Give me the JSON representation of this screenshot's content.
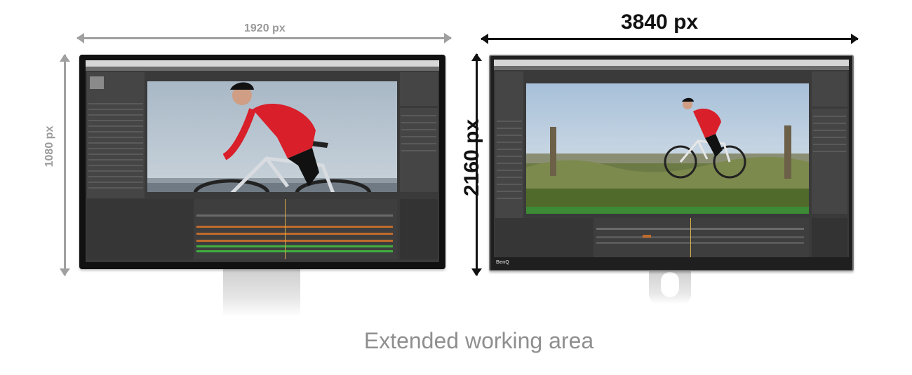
{
  "left_monitor": {
    "width_label": "1920 px",
    "height_label": "1080 px"
  },
  "right_monitor": {
    "width_label": "3840 px",
    "height_label": "2160 px",
    "brand": "BenQ"
  },
  "caption": "Extended working area",
  "colors": {
    "small_arrow": "#a0a0a0",
    "big_arrow": "#111111",
    "cyclist_jersey": "#d81f2a",
    "timeline_orange": "#c06a2c",
    "timeline_green": "#3fae3f"
  },
  "icons": [
    "double-arrow-horizontal",
    "double-arrow-vertical"
  ]
}
